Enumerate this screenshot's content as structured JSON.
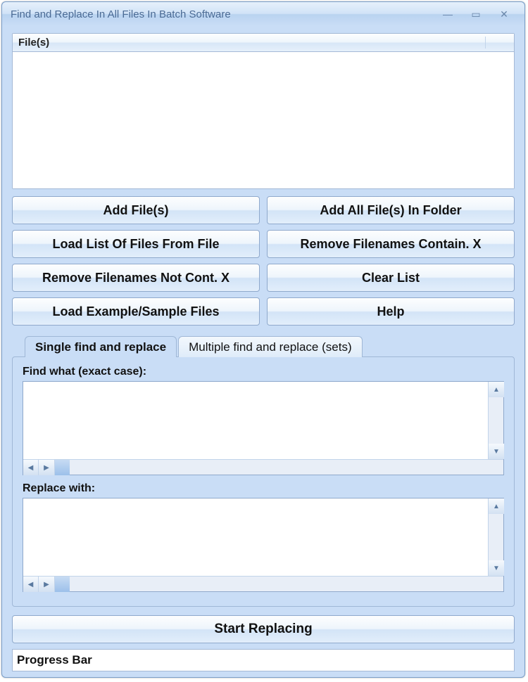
{
  "window": {
    "title": "Find and Replace In All Files In Batch Software"
  },
  "file_list": {
    "header": "File(s)"
  },
  "buttons": {
    "add_files": "Add File(s)",
    "add_all_folder": "Add All File(s) In Folder",
    "load_list": "Load List Of Files From File",
    "remove_contain": "Remove Filenames Contain. X",
    "remove_not_contain": "Remove Filenames Not Cont. X",
    "clear_list": "Clear List",
    "load_example": "Load Example/Sample Files",
    "help": "Help"
  },
  "tabs": {
    "single": "Single find and replace",
    "multiple": "Multiple find and replace (sets)"
  },
  "fields": {
    "find_label": "Find what (exact case):",
    "replace_label": "Replace with:"
  },
  "action": {
    "start": "Start Replacing"
  },
  "progress": {
    "label": "Progress Bar"
  }
}
